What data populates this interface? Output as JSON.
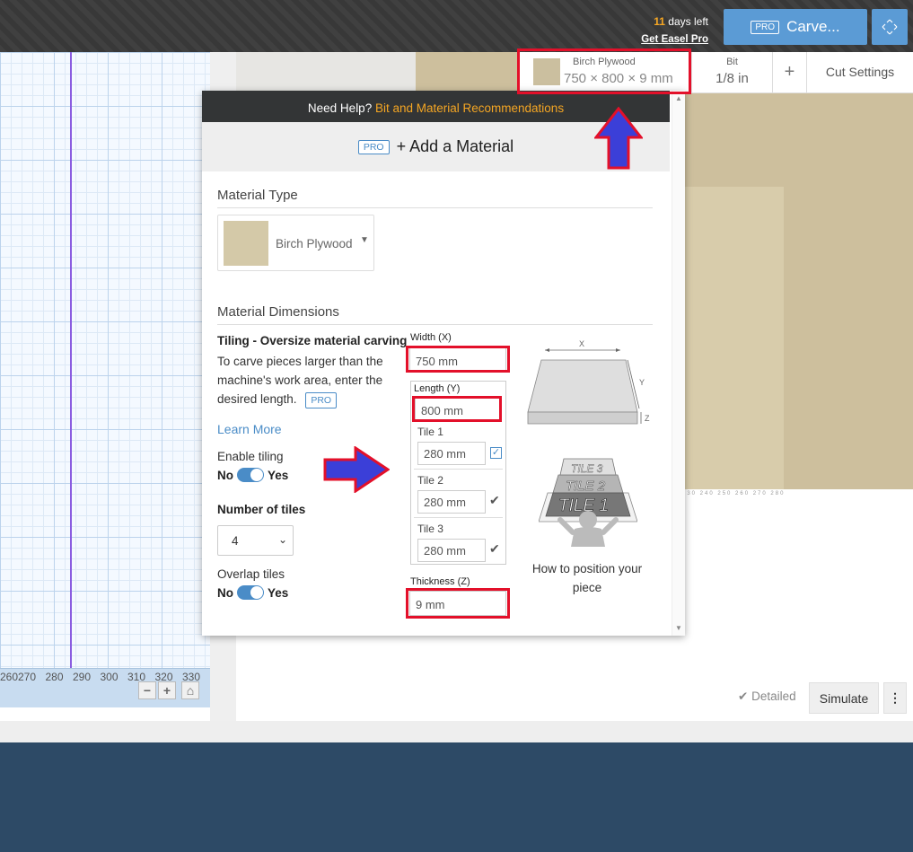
{
  "topbar": {
    "trial_days": "11",
    "trial_suffix": " days left",
    "get_pro": "Get Easel Pro",
    "carve_badge": "PRO",
    "carve_label": "Carve..."
  },
  "ruler": {
    "ticks": [
      "260",
      "270",
      "280",
      "290",
      "300",
      "310",
      "320",
      "330"
    ],
    "zoom_minus": "−",
    "zoom_plus": "+",
    "home": "⌂"
  },
  "ruler3d": "230 240 250 260 270 280",
  "material_bar": {
    "material_name": "Birch Plywood",
    "material_dims": "750 × 800 × 9 mm",
    "bit_label": "Bit",
    "bit_value": "1/8 in",
    "plus": "+",
    "cut_settings": "Cut Settings"
  },
  "modal": {
    "help_prefix": "Need Help? ",
    "help_link": "Bit and Material Recommendations",
    "add_badge": "PRO",
    "add_title": "+ Add a Material",
    "material_type_title": "Material Type",
    "material_type_value": "Birch Plywood",
    "dimensions_title": "Material Dimensions",
    "tiling_title": "Tiling - Oversize material carving",
    "tiling_desc": "To carve pieces larger than the machine's work area, enter the desired length.",
    "tiling_badge": "PRO",
    "learn_more": "Learn More",
    "enable_tiling": "Enable tiling",
    "toggle_no": "No",
    "toggle_yes": "Yes",
    "number_of_tiles": "Number of tiles",
    "tiles_value": "4",
    "overlap_tiles": "Overlap tiles",
    "width_label": "Width (X)",
    "width_value": "750 mm",
    "length_label": "Length (Y)",
    "length_value": "800 mm",
    "tiles": [
      {
        "label": "Tile 1",
        "value": "280 mm"
      },
      {
        "label": "Tile 2",
        "value": "280 mm"
      },
      {
        "label": "Tile 3",
        "value": "280 mm"
      }
    ],
    "thickness_label": "Thickness (Z)",
    "thickness_value": "9 mm",
    "diagram_x": "X",
    "diagram_y": "Y",
    "diagram_z": "Z",
    "stack_tile3": "TILE 3",
    "stack_tile2": "TILE 2",
    "stack_tile1": "TILE 1",
    "howto": "How to position your piece"
  },
  "bottom": {
    "detailed": "Detailed",
    "simulate": "Simulate",
    "more": "⋮"
  },
  "colors": {
    "accent_blue": "#5b9bd5",
    "highlight_red": "#e3102a",
    "arrow_blue": "#3b3fd8",
    "footer_navy": "#2d4a66",
    "link_orange": "#f5a623"
  }
}
